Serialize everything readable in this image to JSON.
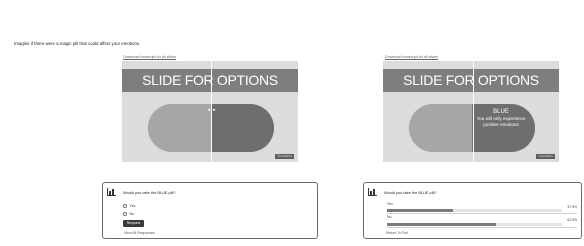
{
  "intro": "Imagine if there were a magic pill that could affect your emotions.",
  "download_link": "Download transcript for all slides",
  "left_slide": {
    "title": "SLIDE FOR OPTIONS",
    "handle": "◂ ▸",
    "badge": "©LEARNING"
  },
  "right_slide": {
    "title": "SLIDE FOR OPTIONS",
    "blue_title": "BLUE",
    "blue_desc": "You will only experience positive emotions",
    "badge": "©LEARNING"
  },
  "poll_question": "Would you take the BLUE pill?",
  "poll_vote": {
    "options": [
      "Yes",
      "No"
    ],
    "respond_label": "Respond",
    "view_all_label": "View All Responses"
  },
  "poll_results": {
    "results": [
      {
        "label": "Yes",
        "pct": "37.5%",
        "fraction": 0.375
      },
      {
        "label": "No",
        "pct": "62.5%",
        "fraction": 0.625
      }
    ],
    "return_label": "Return To Poll"
  },
  "colors": {
    "slide_bg": "#dcdcdc",
    "slide_header": "#7e7e7e",
    "pill_left": "#a6a6a6",
    "pill_right": "#6e6e6e",
    "bar_fill": "#7a7a7a",
    "poll_border": "#6a6a6a"
  },
  "icons": {
    "poll": "bar-chart-icon",
    "radio": "radio-button-icon",
    "slider": "slider-arrows-icon"
  }
}
